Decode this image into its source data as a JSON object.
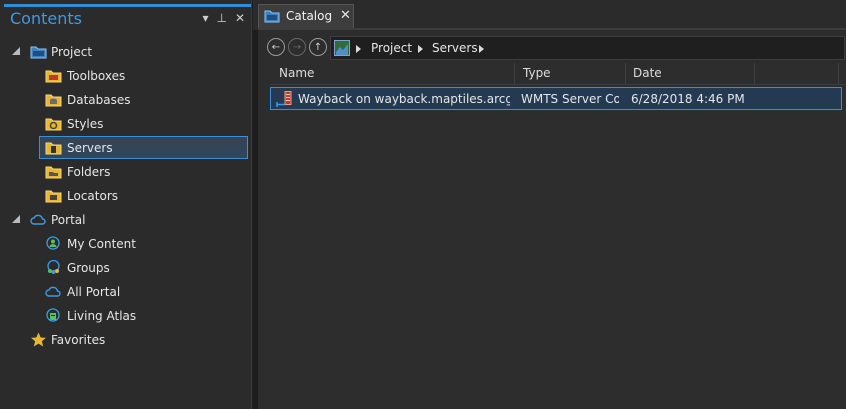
{
  "contents": {
    "title": "Contents",
    "controls": {
      "menu": "▾",
      "pin": "⊥",
      "close": "✕"
    },
    "tree": {
      "project": {
        "label": "Project",
        "children": [
          {
            "label": "Toolboxes"
          },
          {
            "label": "Databases"
          },
          {
            "label": "Styles"
          },
          {
            "label": "Servers",
            "selected": true
          },
          {
            "label": "Folders"
          },
          {
            "label": "Locators"
          }
        ]
      },
      "portal": {
        "label": "Portal",
        "children": [
          {
            "label": "My Content"
          },
          {
            "label": "Groups"
          },
          {
            "label": "All Portal"
          },
          {
            "label": "Living Atlas"
          }
        ]
      },
      "favorites": {
        "label": "Favorites"
      }
    }
  },
  "catalog": {
    "tab_label": "Catalog",
    "tab_close": "✕",
    "nav": {
      "back": "←",
      "forward": "→",
      "up": "↑"
    },
    "breadcrumb": [
      "Project",
      "Servers"
    ],
    "columns": [
      "Name",
      "Type",
      "Date"
    ],
    "rows": [
      {
        "name": "Wayback on wayback.maptiles.arcgis.com",
        "type": "WMTS Server Connection",
        "date": "6/28/2018 4:46 PM"
      }
    ]
  },
  "colors": {
    "accent": "#2e8fd9",
    "selection_border": "#3a8fd6",
    "folder_yellow": "#f0c23a"
  }
}
